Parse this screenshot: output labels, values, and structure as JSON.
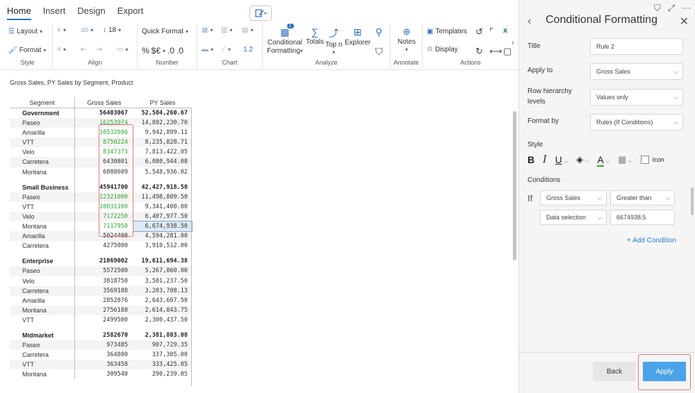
{
  "ribbon": {
    "tabs": [
      "Home",
      "Insert",
      "Design",
      "Export"
    ],
    "active_tab": "Home",
    "style_group": {
      "label": "Style",
      "layout": "Layout",
      "format": "Format"
    },
    "align_group": {
      "label": "Align"
    },
    "number_group": {
      "label": "Number",
      "font_size": "18",
      "quick_format": "Quick Format",
      "percent": "%",
      "currency": "$€",
      "decimals_up": ".0",
      "decimals_down": ".0"
    },
    "chart_group": {
      "label": "Chart",
      "scale": "1.2"
    },
    "analyze_group": {
      "label": "Analyze",
      "conditional": "Conditional",
      "formatting": "Formatting",
      "badge": "1",
      "totals": "Totals",
      "topn": "Top n",
      "explorer": "Explorer"
    },
    "annotate_group": {
      "label": "Annotate",
      "notes": "Notes"
    },
    "actions_group": {
      "label": "Actions",
      "templates": "Templates",
      "display": "Display"
    }
  },
  "report": {
    "title": "Gross Sales, PY Sales by Segment, Product",
    "headers": [
      "Segment",
      "Gross Sales",
      "PY Sales"
    ],
    "groups": [
      {
        "name": "Government",
        "gross": "56403067",
        "py": "52,504,260.67",
        "rows": [
          {
            "name": "Paseo",
            "gross": "16253974",
            "py": "14,882,230.70",
            "green": true
          },
          {
            "name": "Amarilla",
            "gross": "10532086",
            "py": "9,942,899.11",
            "green": true
          },
          {
            "name": "VTT",
            "gross": "8750224",
            "py": "8,235,828.71",
            "green": true
          },
          {
            "name": "Velo",
            "gross": "8347373",
            "py": "7,813,422.05",
            "green": true
          },
          {
            "name": "Carretera",
            "gross": "6430801",
            "py": "6,080,944.08",
            "green": false
          },
          {
            "name": "Montana",
            "gross": "6088609",
            "py": "5,548,936.02",
            "green": false
          }
        ]
      },
      {
        "name": "Small Business",
        "gross": "45941700",
        "py": "42,427,918.50",
        "rows": [
          {
            "name": "Paseo",
            "gross": "12321000",
            "py": "11,498,809.50",
            "green": true
          },
          {
            "name": "VTT",
            "gross": "10031100",
            "py": "9,341,400.00",
            "green": true
          },
          {
            "name": "Velo",
            "gross": "7172250",
            "py": "6,407,977.50",
            "green": true
          },
          {
            "name": "Montana",
            "gross": "7117950",
            "py": "6,674,938.50",
            "green": true,
            "selected": true
          },
          {
            "name": "Amarilla",
            "gross": "5024400",
            "py": "4,594,281.00",
            "green": false
          },
          {
            "name": "Carretera",
            "gross": "4275000",
            "py": "3,910,512.00",
            "green": false
          }
        ]
      },
      {
        "name": "Enterprise",
        "gross": "21069002",
        "py": "19,611,694.38",
        "rows": [
          {
            "name": "Paseo",
            "gross": "5572500",
            "py": "5,267,860.00",
            "green": false
          },
          {
            "name": "Velo",
            "gross": "3818750",
            "py": "3,581,237.50",
            "green": false
          },
          {
            "name": "Carretera",
            "gross": "3569188",
            "py": "3,203,708.13",
            "green": false
          },
          {
            "name": "Amarilla",
            "gross": "2852876",
            "py": "2,643,607.50",
            "green": false
          },
          {
            "name": "Montana",
            "gross": "2756188",
            "py": "2,614,843.75",
            "green": false
          },
          {
            "name": "VTT",
            "gross": "2499500",
            "py": "2,300,437.50",
            "green": false
          }
        ]
      },
      {
        "name": "Midmarket",
        "gross": "2582670",
        "py": "2,381,883.08",
        "rows": [
          {
            "name": "Paseo",
            "gross": "973485",
            "py": "907,729.35",
            "green": false
          },
          {
            "name": "Carretera",
            "gross": "364800",
            "py": "337,305.00",
            "green": false
          },
          {
            "name": "VTT",
            "gross": "363458",
            "py": "333,425.85",
            "green": false
          },
          {
            "name": "Montana",
            "gross": "309540",
            "py": "290,239.05",
            "green": false
          }
        ]
      }
    ]
  },
  "panel": {
    "title": "Conditional Formatting",
    "title_label": "Title",
    "title_value": "Rule 2",
    "apply_to_label": "Apply to",
    "apply_to_value": "Gross Sales",
    "row_hierarchy_label_1": "Row hierarchy",
    "row_hierarchy_label_2": "levels",
    "row_hierarchy_value": "Values only",
    "format_by_label": "Format by",
    "format_by_value": "Rules (If Conditions)",
    "style_label": "Style",
    "bold": "B",
    "italic": "I",
    "underline": "U",
    "font_color": "A",
    "icon_label": "Icon",
    "conditions_label": "Conditions",
    "if_label": "If",
    "cond_field": "Gross Sales",
    "cond_operator": "Greater than",
    "cond_source": "Data selection",
    "cond_value": "6674938.5",
    "add_condition": "+ Add Condition",
    "back_button": "Back",
    "apply_button": "Apply"
  },
  "colors": {
    "accent": "#4aa3e8",
    "green_value": "#2ea82e",
    "highlight": "#e07a7a"
  }
}
